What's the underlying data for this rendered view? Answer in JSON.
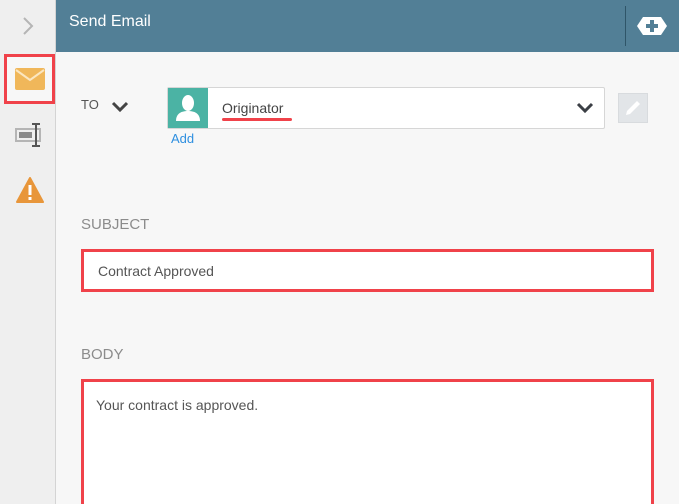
{
  "header": {
    "title": "Send Email"
  },
  "sidebar": {
    "items": [
      {
        "name": "expand",
        "icon": "chevron-right-icon"
      },
      {
        "name": "email",
        "icon": "envelope-icon",
        "active": true
      },
      {
        "name": "field",
        "icon": "text-field-icon"
      },
      {
        "name": "warning",
        "icon": "warning-icon"
      }
    ]
  },
  "to": {
    "label": "TO",
    "recipient": "Originator",
    "add_label": "Add"
  },
  "subject": {
    "label": "SUBJECT",
    "value": "Contract Approved"
  },
  "body": {
    "label": "BODY",
    "value": "Your contract is approved."
  },
  "colors": {
    "header_bg": "#527f96",
    "highlight": "#f0424a",
    "avatar_bg": "#4bb3a4",
    "mail_icon": "#f0b75a",
    "warning_icon": "#e8963a",
    "link": "#2e8fe0"
  }
}
